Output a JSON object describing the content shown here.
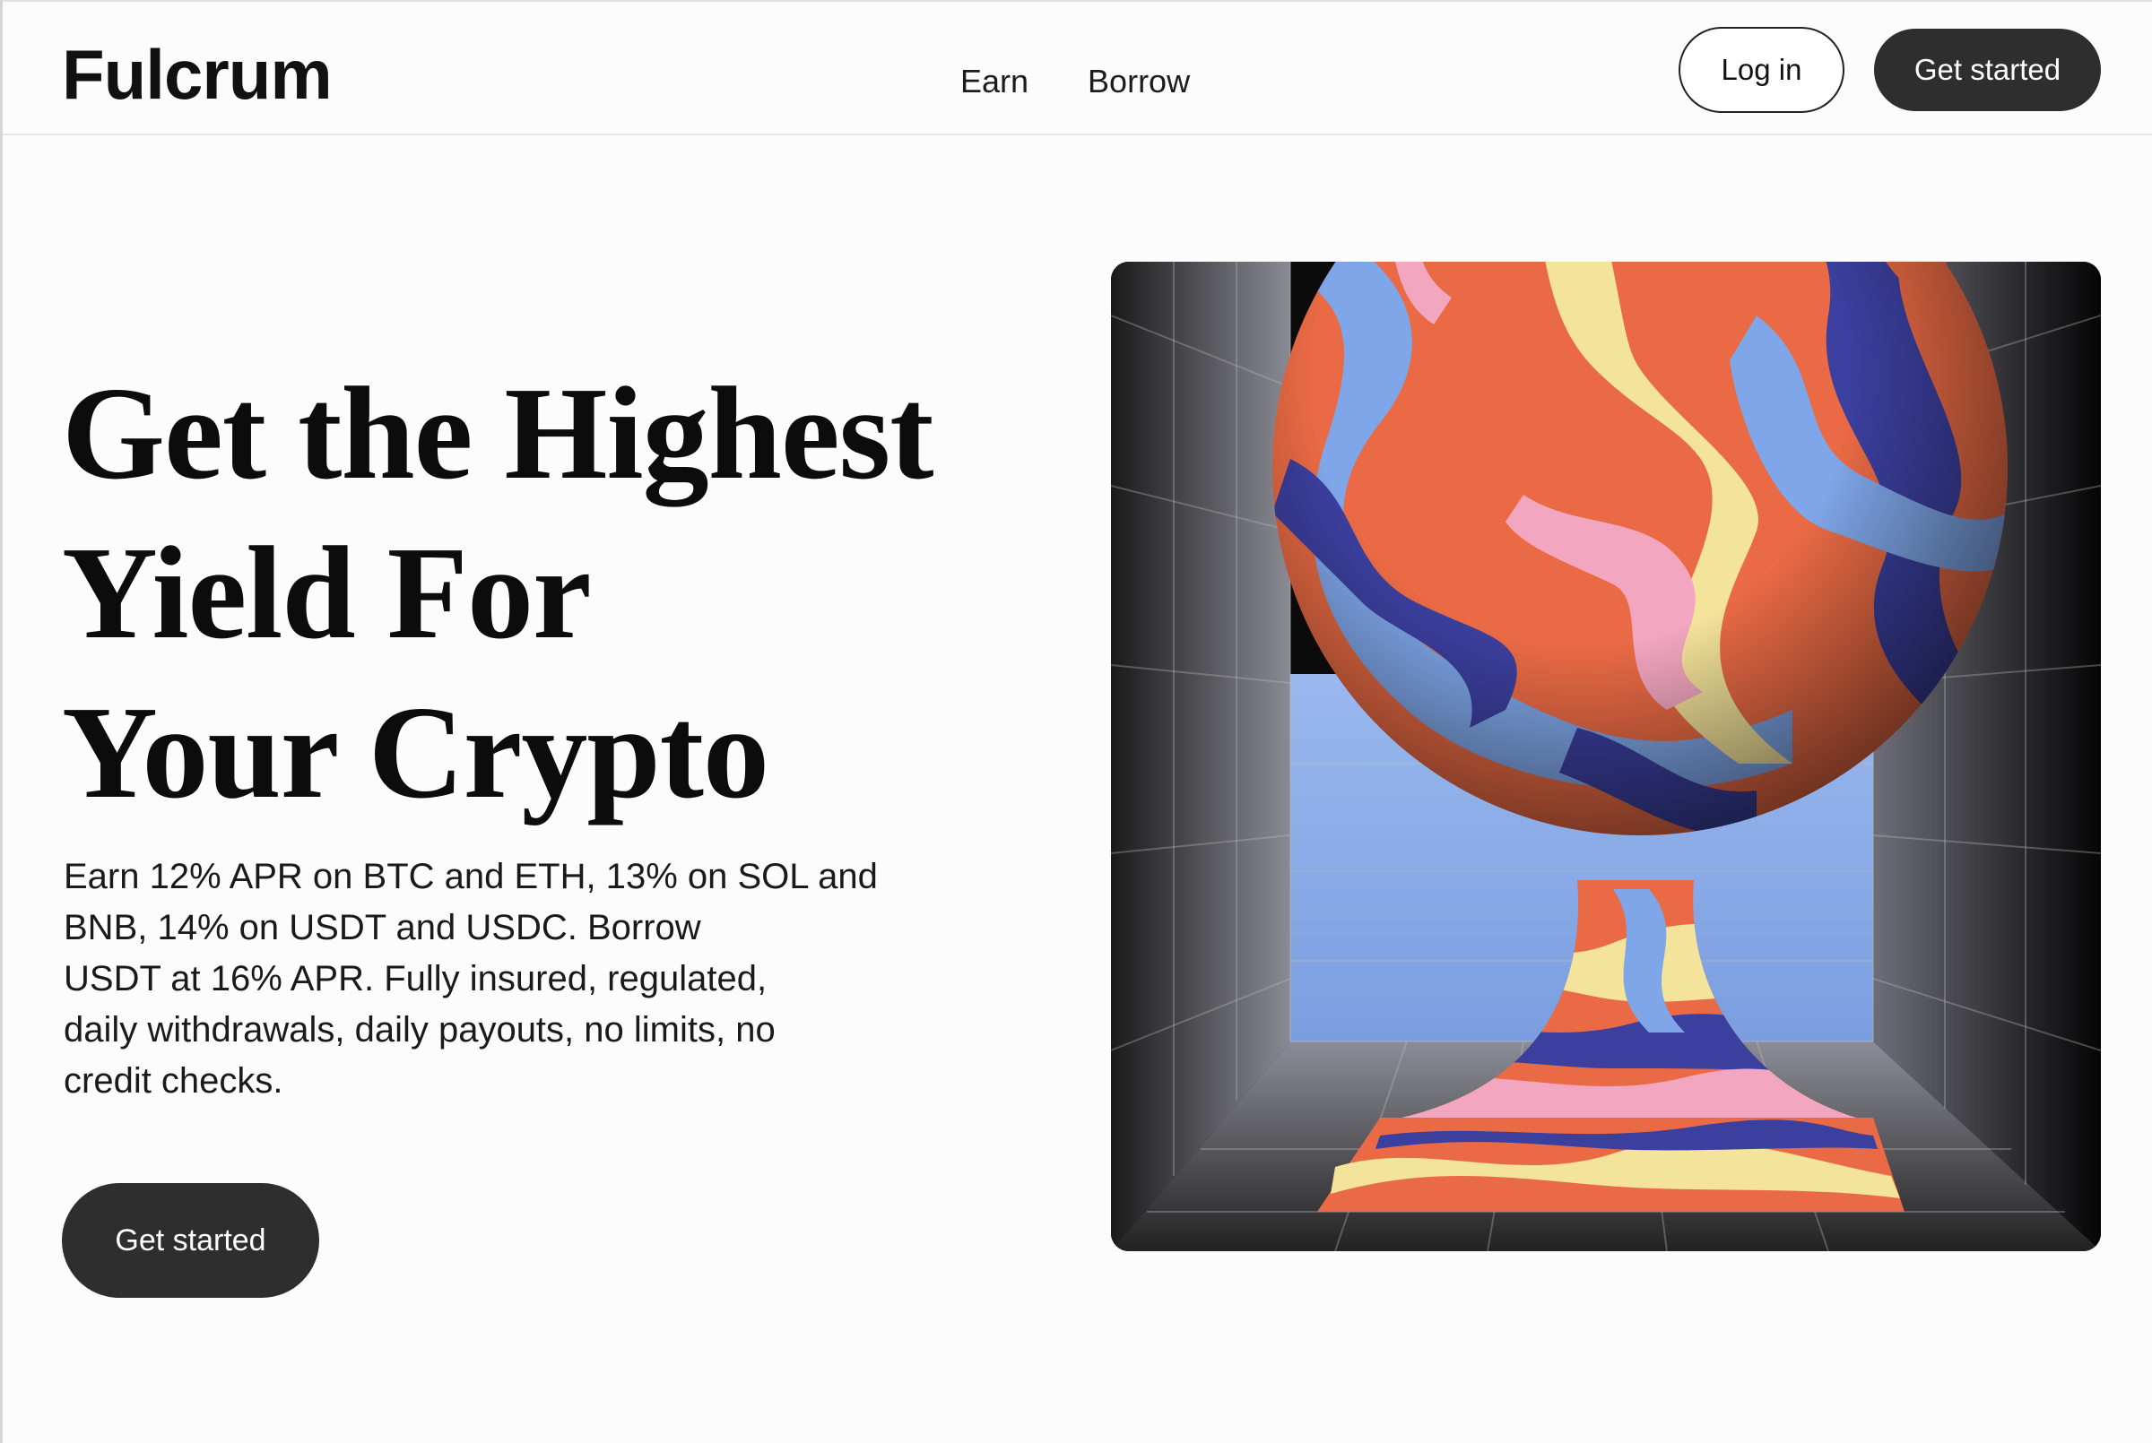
{
  "brand": {
    "logo_text": "Fulcrum"
  },
  "nav": {
    "items": [
      {
        "label": "Earn"
      },
      {
        "label": "Borrow"
      }
    ]
  },
  "header_actions": {
    "login_label": "Log in",
    "get_started_label": "Get started"
  },
  "hero": {
    "headline_lines": [
      "Get the Highest",
      "Yield For",
      "Your Crypto"
    ],
    "description_lines": [
      "Earn 12% APR on BTC and ETH, 13% on SOL and",
      "BNB, 14% on USDT and USDC. Borrow",
      "USDT at 16% APR. Fully insured, regulated,",
      "daily withdrawals, daily payouts, no limits, no",
      "credit checks."
    ],
    "cta_label": "Get started",
    "illustration": "marbled-sphere-on-pedestal-in-tiled-room"
  },
  "colors": {
    "background": "#fcfcfc",
    "text": "#111111",
    "button_dark": "#2e2e2e",
    "button_text": "#ffffff"
  }
}
